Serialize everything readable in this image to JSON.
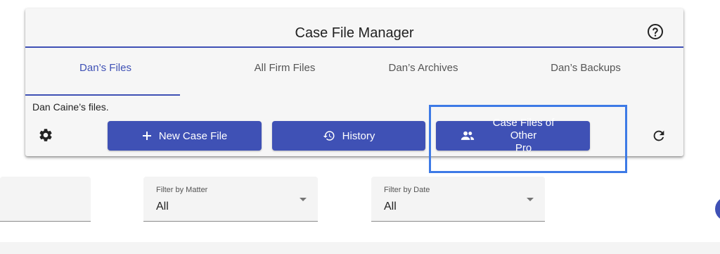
{
  "header": {
    "title": "Case File Manager"
  },
  "tabs": [
    {
      "label": "Dan’s Files",
      "active": true
    },
    {
      "label": "All Firm Files",
      "active": false
    },
    {
      "label": "Dan’s Archives",
      "active": false
    },
    {
      "label": "Dan’s Backups",
      "active": false
    }
  ],
  "description": "Dan Caine’s files.",
  "toolbar": {
    "new_case_file_label": "New Case File",
    "history_label": "History",
    "case_files_other_line1": "Case Files of Other",
    "case_files_other_line2": "Pro"
  },
  "filters": {
    "matter": {
      "label": "Filter by Matter",
      "value": "All"
    },
    "date": {
      "label": "Filter by Date",
      "value": "All"
    }
  },
  "icons": [
    "help-icon",
    "gear-icon",
    "plus-icon",
    "history-icon",
    "people-icon",
    "refresh-icon"
  ],
  "colors": {
    "accent": "#3f51b5",
    "highlight": "#3d7ae6",
    "card_bg": "#f6f6f6"
  }
}
